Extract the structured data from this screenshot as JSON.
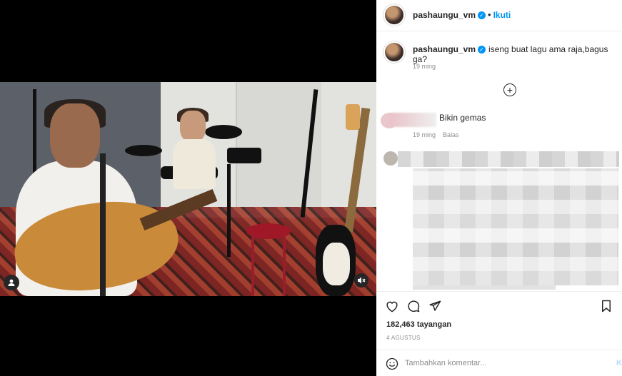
{
  "post": {
    "username": "pashaungu_vm",
    "verified": true,
    "follow_label": "Ikuti",
    "dot": "•",
    "caption": "iseng buat lagu ama raja,bagus ga?",
    "caption_time": "19 ming",
    "views": "182,463 tayangan",
    "date": "4 AGUSTUS"
  },
  "comments": [
    {
      "text": "Bikin gemas",
      "time": "19 ming",
      "reply_label": "Balas"
    }
  ],
  "comment_box": {
    "placeholder": "Tambahkan komentar...",
    "post_label": "K"
  },
  "icons": {
    "verified": "verified-badge-icon",
    "add": "add-circle-icon",
    "like": "heart-icon",
    "comment": "comment-icon",
    "share": "share-icon",
    "save": "bookmark-icon",
    "emoji": "emoji-icon",
    "tag": "user-tag-icon",
    "mute": "muted-speaker-icon"
  },
  "colors": {
    "accent": "#0095f6",
    "text": "#262626",
    "muted": "#8e8e8e"
  }
}
